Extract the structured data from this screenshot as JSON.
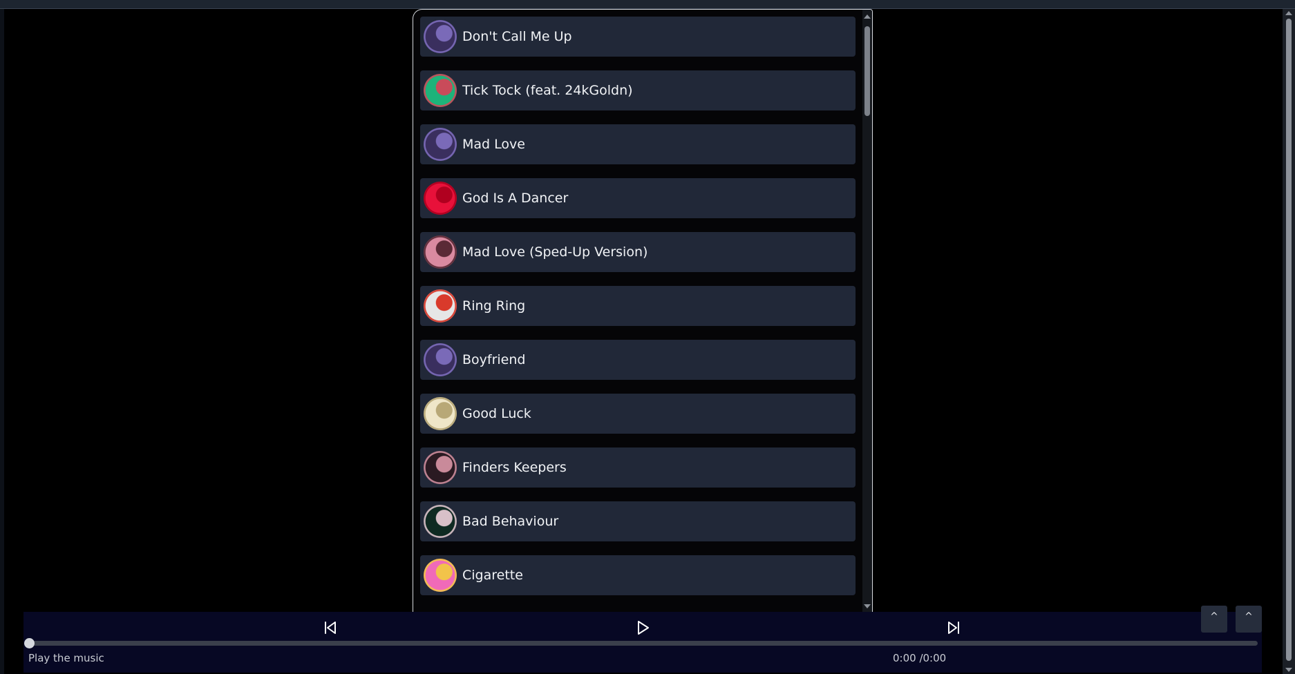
{
  "playlist": {
    "tracks": [
      {
        "title": "Don't Call Me Up",
        "cover": "portrait-blue-ring-icon",
        "cover_colors": [
          "#3a2f5e",
          "#7a6ab8"
        ]
      },
      {
        "title": "Tick Tock (feat. 24kGoldn)",
        "cover": "green-framed-portrait-icon",
        "cover_colors": [
          "#1db37a",
          "#c94b5a"
        ]
      },
      {
        "title": "Mad Love",
        "cover": "portrait-blue-ring-icon",
        "cover_colors": [
          "#3a2f5e",
          "#7a6ab8"
        ]
      },
      {
        "title": "God Is A Dancer",
        "cover": "red-splash-icon",
        "cover_colors": [
          "#e8113a",
          "#b0001f"
        ]
      },
      {
        "title": "Mad Love (Sped-Up Version)",
        "cover": "pink-portrait-icon",
        "cover_colors": [
          "#d98aa0",
          "#5a2a36"
        ]
      },
      {
        "title": "Ring Ring",
        "cover": "comic-poster-icon",
        "cover_colors": [
          "#e6e6e6",
          "#d93a2b"
        ]
      },
      {
        "title": "Boyfriend",
        "cover": "portrait-blue-ring-icon",
        "cover_colors": [
          "#3a2f5e",
          "#7a6ab8"
        ]
      },
      {
        "title": "Good Luck",
        "cover": "pale-portrait-icon",
        "cover_colors": [
          "#efe6c8",
          "#b8a877"
        ]
      },
      {
        "title": "Finders Keepers",
        "cover": "dark-pink-portrait-icon",
        "cover_colors": [
          "#2a1a22",
          "#c98a9a"
        ]
      },
      {
        "title": "Bad Behaviour",
        "cover": "dark-green-portrait-icon",
        "cover_colors": [
          "#0f2a22",
          "#d8c0c8"
        ]
      },
      {
        "title": "Cigarette",
        "cover": "pink-cigarette-cover-icon",
        "cover_colors": [
          "#f06ab8",
          "#f2c34a"
        ]
      }
    ]
  },
  "player": {
    "status": "Play the music",
    "time": "0:00 /0:00",
    "progress": 0,
    "expand_label_1": "^",
    "expand_label_2": "^"
  },
  "colors": {
    "background": "#000000",
    "track_row": "#212838",
    "player_bar": "#070824"
  }
}
